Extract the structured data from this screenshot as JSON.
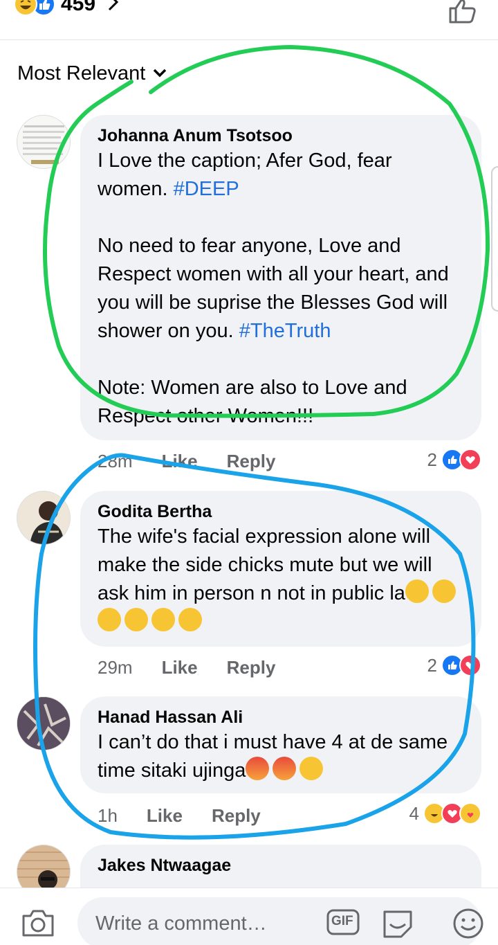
{
  "header": {
    "reaction_count": "459",
    "reaction_icons": [
      "haha-icon",
      "like-icon"
    ]
  },
  "sort": {
    "label": "Most Relevant"
  },
  "comments": [
    {
      "author": "Johanna Anum Tsotsoo",
      "text_a": "I Love the caption; Afer God, fear women. ",
      "tag_a": "#DEEP",
      "text_b": "\n\nNo need to fear anyone, Love and Respect women with all your heart, and you will be suprise the Blesses God will shower on you. ",
      "tag_b": "#TheTruth",
      "text_c": "\n\nNote: Women are also to Love and Respect other Women!!!",
      "time": "28m",
      "like_label": "Like",
      "reply_label": "Reply",
      "reaction_count": "2"
    },
    {
      "author": "Godita Bertha",
      "text": "The wife's facial expression alone will make the side chicks mute but we will ask him in person n not in public la",
      "emojis": [
        "laughing-tears",
        "laughing-tears",
        "laughing-tears",
        "laughing-tears",
        "laughing-tears",
        "laughing-tears"
      ],
      "time": "29m",
      "like_label": "Like",
      "reply_label": "Reply",
      "reaction_count": "2"
    },
    {
      "author": "Hanad Hassan Ali",
      "text": "I can’t do that i must have 4 at de same time sitaki ujinga",
      "emojis": [
        "angry",
        "angry",
        "flushed"
      ],
      "time": "1h",
      "like_label": "Like",
      "reply_label": "Reply",
      "reaction_count": "4"
    },
    {
      "author": "Jakes Ntwaagae",
      "text": ""
    }
  ],
  "composer": {
    "placeholder": "Write a comment…",
    "gif_label": "GIF"
  },
  "colors": {
    "accent_blue": "#1877f2",
    "hashtag": "#216fdb",
    "bubble": "#f0f2f5",
    "annotation_green": "#22cc55",
    "annotation_blue": "#1aa3e8"
  }
}
